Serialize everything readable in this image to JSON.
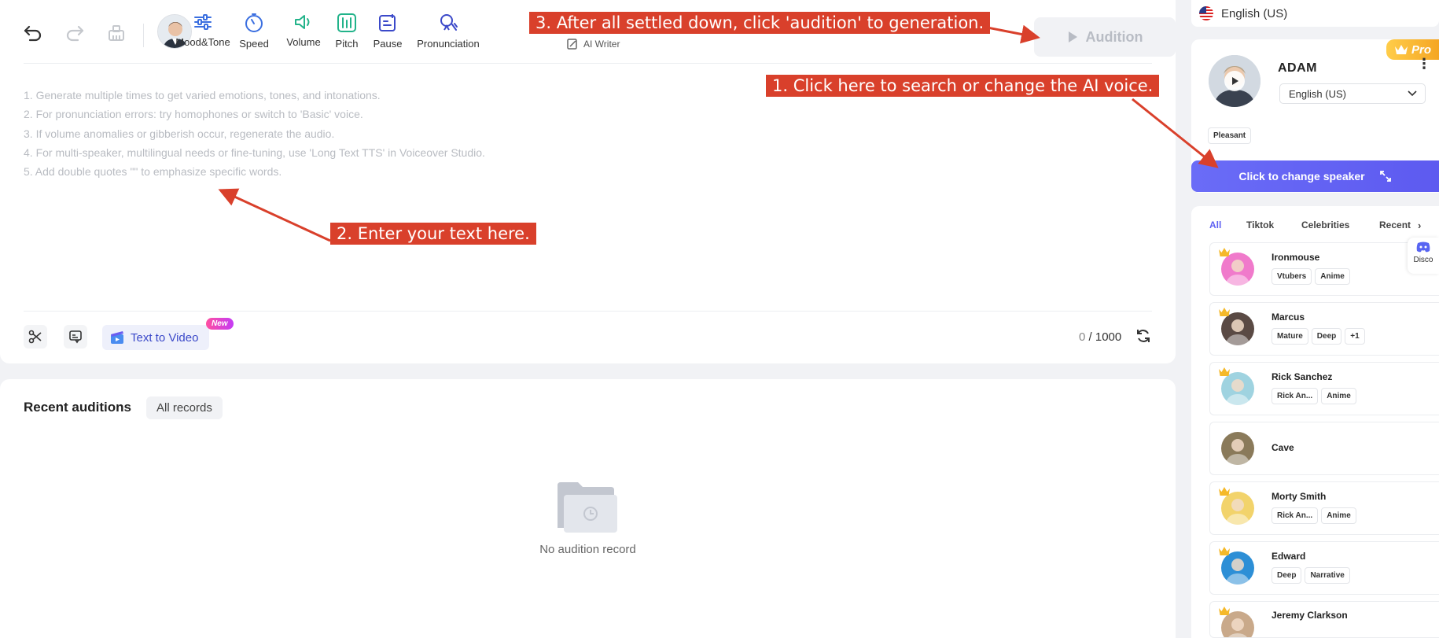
{
  "toolbar": {
    "tools": [
      {
        "label": "Mood&Tone",
        "icon": "sliders-icon",
        "color": "#3b6fe0"
      },
      {
        "label": "Speed",
        "icon": "speedometer-icon",
        "color": "#3b6fe0"
      },
      {
        "label": "Volume",
        "icon": "volume-icon",
        "color": "#22b38a"
      },
      {
        "label": "Pitch",
        "icon": "pitch-icon",
        "color": "#22b38a"
      },
      {
        "label": "Pause",
        "icon": "pause-icon",
        "color": "#3b49c9"
      },
      {
        "label": "Pronunciation",
        "icon": "pronunciation-icon",
        "color": "#3b49c9"
      }
    ],
    "ai_writer": "AI Writer",
    "audition": "Audition"
  },
  "editor": {
    "hints": [
      "1. Generate multiple times to get varied emotions, tones, and intonations.",
      "2. For pronunciation errors: try homophones or switch to 'Basic' voice.",
      "3. If volume anomalies or gibberish occur, regenerate the audio.",
      "4. For multi-speaker, multilingual needs or fine-tuning, use 'Long Text TTS' in Voiceover Studio.",
      "5. Add double quotes \"\" to emphasize specific words."
    ],
    "text_to_video": "Text to Video",
    "new_badge": "New",
    "char_count": "0",
    "char_limit": "/ 1000"
  },
  "recent": {
    "title": "Recent auditions",
    "all_records": "All records",
    "empty_text": "No audition record"
  },
  "right_panel": {
    "language": "English (US)",
    "pro_badge": "Pro",
    "speaker": {
      "name": "ADAM",
      "language": "English (US)",
      "tag": "Pleasant"
    },
    "change_speaker": "Click to change speaker",
    "tabs": [
      "All",
      "Tiktok",
      "Celebrities",
      "Recent"
    ],
    "discord": "Disco",
    "voices": [
      {
        "name": "Ironmouse",
        "tags": [
          "Vtubers",
          "Anime"
        ],
        "avatar_color": "#f07acb"
      },
      {
        "name": "Marcus",
        "tags": [
          "Mature",
          "Deep",
          "+1"
        ],
        "avatar_color": "#5a4a44"
      },
      {
        "name": "Rick Sanchez",
        "tags": [
          "Rick An...",
          "Anime"
        ],
        "avatar_color": "#9fd3e0"
      },
      {
        "name": "Cave",
        "tags": [],
        "avatar_color": "#8a7a5a"
      },
      {
        "name": "Morty Smith",
        "tags": [
          "Rick An...",
          "Anime"
        ],
        "avatar_color": "#f2d36b"
      },
      {
        "name": "Edward",
        "tags": [
          "Deep",
          "Narrative"
        ],
        "avatar_color": "#2d8fd6"
      },
      {
        "name": "Jeremy Clarkson",
        "tags": [],
        "avatar_color": "#c9a98a"
      }
    ]
  },
  "annotations": {
    "step1": "1. Click here to search or change the AI voice.",
    "step2": "2. Enter your text here.",
    "step3": "3. After all settled down, click 'audition' to generation."
  },
  "colors": {
    "accent": "#5f62f2",
    "annotation": "#d9402b",
    "pro": "#f5a623"
  }
}
